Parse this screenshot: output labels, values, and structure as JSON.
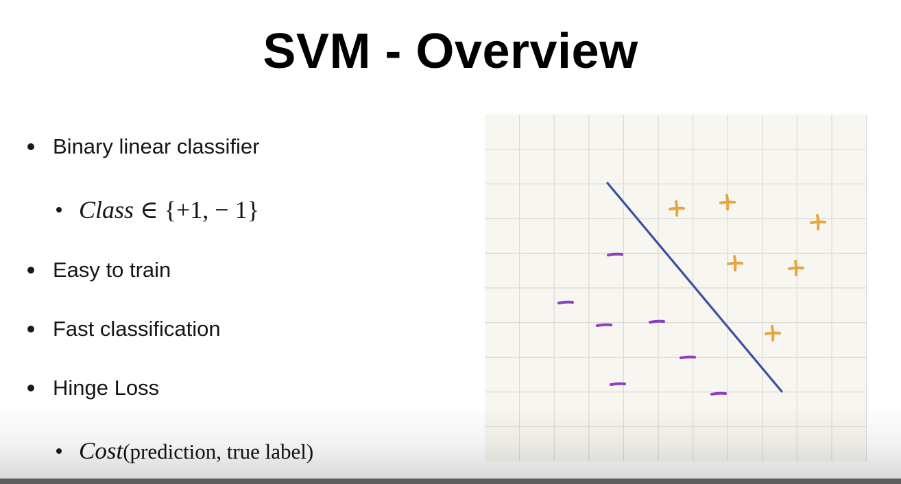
{
  "slide": {
    "title": "SVM - Overview",
    "bullets": [
      {
        "level": 1,
        "text": "Binary linear classifier"
      },
      {
        "level": 2,
        "var": "Class",
        "rest": " ∈ {+1, − 1}"
      },
      {
        "level": 1,
        "text": "Easy to train"
      },
      {
        "level": 1,
        "text": "Fast classification"
      },
      {
        "level": 1,
        "text": "Hinge Loss"
      },
      {
        "level": 2,
        "var": "Cost",
        "rest": "(prediction, true label)"
      }
    ]
  },
  "figure": {
    "plus_symbol": "+",
    "minus_symbol": "−",
    "colors": {
      "background": "#f8f6f0",
      "grid": "#dcdad4",
      "line": "#3b4fa0",
      "plus": "#e5a63b",
      "minus": "#8c3fc1"
    }
  }
}
